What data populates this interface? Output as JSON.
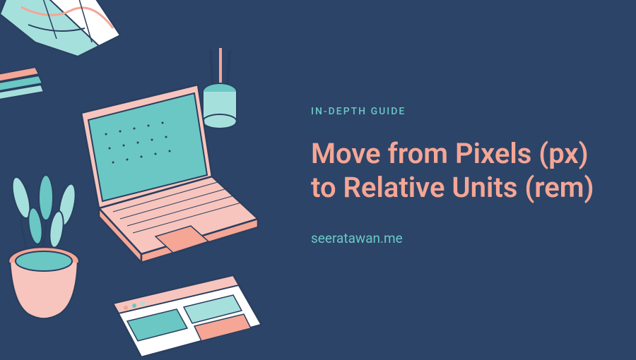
{
  "eyebrow": "IN-DEPTH GUIDE",
  "headline": "Move from Pixels (px) to Relative Units (rem)",
  "site": "seeratawan.me",
  "colors": {
    "bg": "#2c4468",
    "teal": "#6bc7c4",
    "tealLight": "#a6e0dd",
    "salmon": "#f5a695",
    "pink": "#f7c5bd",
    "dark": "#2a3f5f"
  }
}
